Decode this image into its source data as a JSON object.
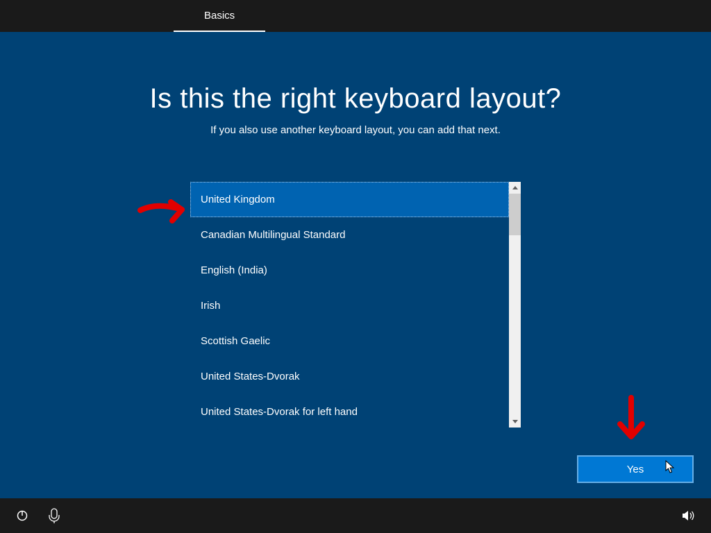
{
  "topBar": {
    "tabs": [
      {
        "label": "Basics",
        "active": true
      }
    ]
  },
  "main": {
    "title": "Is this the right keyboard layout?",
    "subtitle": "If you also use another keyboard layout, you can add that next.",
    "layouts": [
      {
        "label": "United Kingdom",
        "selected": true
      },
      {
        "label": "Canadian Multilingual Standard",
        "selected": false
      },
      {
        "label": "English (India)",
        "selected": false
      },
      {
        "label": "Irish",
        "selected": false
      },
      {
        "label": "Scottish Gaelic",
        "selected": false
      },
      {
        "label": "United States-Dvorak",
        "selected": false
      },
      {
        "label": "United States-Dvorak for left hand",
        "selected": false
      }
    ],
    "yesLabel": "Yes"
  },
  "bottomBar": {
    "icons": {
      "power": "power-icon",
      "accessibility": "accessibility-icon",
      "volume": "volume-icon"
    }
  },
  "colors": {
    "pageBg": "#004275",
    "barBg": "#1a1a1a",
    "selectedBg": "#0063b1",
    "buttonBg": "#0078d4",
    "annotation": "#e10000"
  }
}
